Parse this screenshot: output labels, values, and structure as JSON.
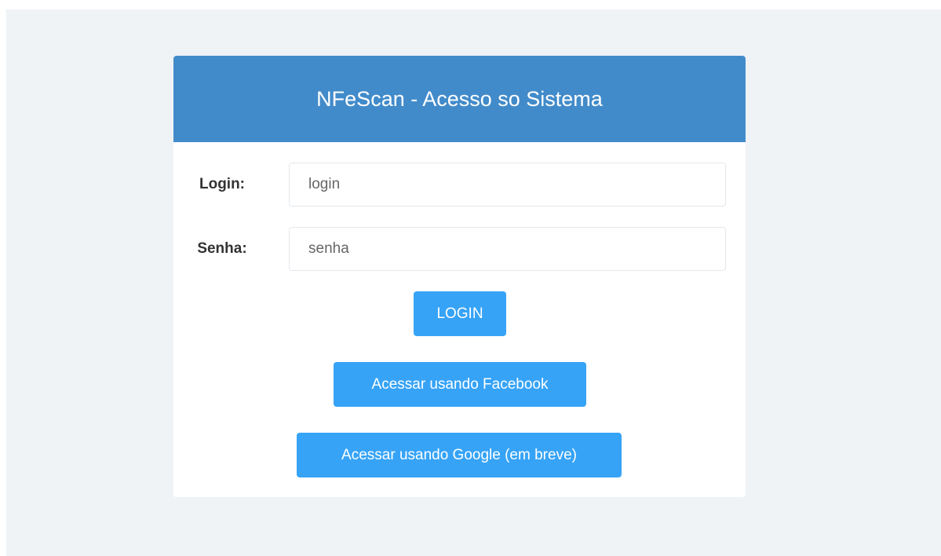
{
  "header": {
    "title": "NFeScan - Acesso so Sistema"
  },
  "form": {
    "login_label": "Login:",
    "login_placeholder": "login",
    "senha_label": "Senha:",
    "senha_placeholder": "senha"
  },
  "buttons": {
    "login": "LOGIN",
    "facebook": "Acessar usando Facebook",
    "google": "Acessar usando Google (em breve)"
  },
  "colors": {
    "header_background": "#428bca",
    "button_background": "#36a3f7",
    "page_background": "#eff3f6"
  }
}
